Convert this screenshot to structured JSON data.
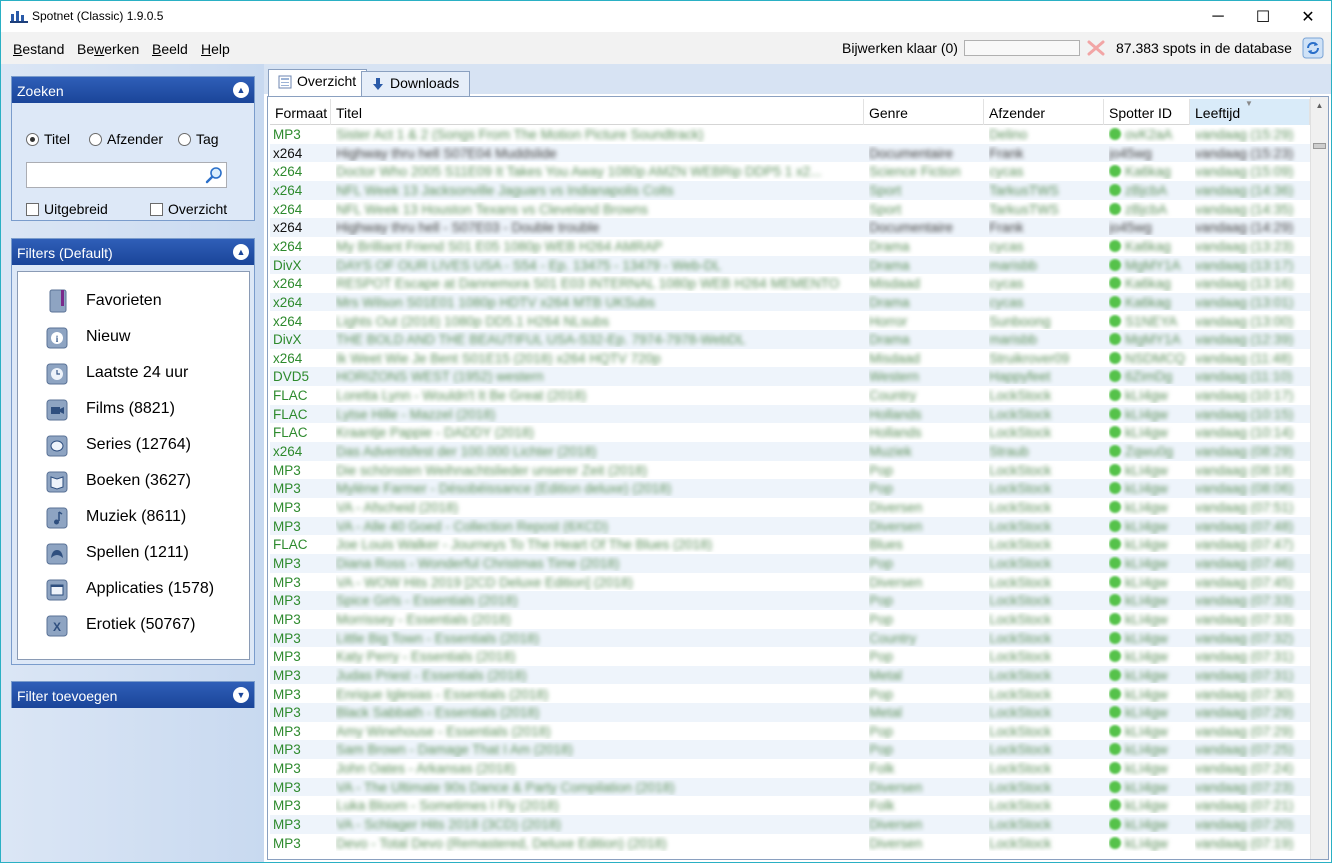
{
  "app": {
    "title": "Spotnet (Classic) 1.9.0.5",
    "window_controls": {
      "minimize": "─",
      "maximize": "☐",
      "close": "✕"
    }
  },
  "menu": {
    "items": [
      {
        "accel": "B",
        "rest": "estand"
      },
      {
        "pre": "Be",
        "accel": "w",
        "rest": "erken"
      },
      {
        "accel": "B",
        "rest": "eeld"
      },
      {
        "accel": "H",
        "rest": "elp"
      }
    ]
  },
  "status": {
    "update_label": "Bijwerken klaar (0)",
    "progress": 0,
    "spot_count": "87.383 spots in de database",
    "progress_color": "#06b025"
  },
  "search_panel": {
    "header": "Zoeken",
    "radios": [
      {
        "label": "Titel",
        "checked": true
      },
      {
        "label": "Afzender",
        "checked": false
      },
      {
        "label": "Tag",
        "checked": false
      }
    ],
    "search_value": "",
    "checkboxes": [
      {
        "label": "Uitgebreid",
        "checked": false
      },
      {
        "label": "Overzicht",
        "checked": false
      }
    ]
  },
  "filters_panel": {
    "header": "Filters (Default)",
    "items": [
      {
        "label": "Favorieten",
        "icon": "bookmark-icon"
      },
      {
        "label": "Nieuw",
        "icon": "info-icon"
      },
      {
        "label": "Laatste 24 uur",
        "icon": "clock-icon"
      },
      {
        "label": "Films (8821)",
        "icon": "video-camera-icon"
      },
      {
        "label": "Series (12764)",
        "icon": "tv-icon"
      },
      {
        "label": "Boeken (3627)",
        "icon": "book-icon"
      },
      {
        "label": "Muziek (8611)",
        "icon": "music-note-icon"
      },
      {
        "label": "Spellen (1211)",
        "icon": "gamepad-icon"
      },
      {
        "label": "Applicaties (1578)",
        "icon": "application-icon"
      },
      {
        "label": "Erotiek (50767)",
        "icon": "x-icon"
      }
    ]
  },
  "add_filter_panel": {
    "header": "Filter toevoegen"
  },
  "tabs": [
    {
      "label": "Overzicht",
      "active": true
    },
    {
      "label": "Downloads",
      "active": false
    }
  ],
  "grid": {
    "columns": [
      "Formaat",
      "Titel",
      "Genre",
      "Afzender",
      "Spotter ID",
      "Leeftijd"
    ],
    "sorted_column": "Leeftijd",
    "rows": [
      {
        "format": "MP3",
        "title": "Sister Act 1 & 2 (Songs From The Motion Picture Soundtrack)",
        "genre": "",
        "sender": "Delino",
        "spotter_id": "ovK2aA",
        "age": "vandaag (15:29)",
        "dark": false
      },
      {
        "format": "x264",
        "title": "Highway thru hell S07E04 Muddslide",
        "genre": "Documentaire",
        "sender": "Frank",
        "spotter_id": "jo45wg",
        "age": "vandaag (15:23)",
        "dark": true
      },
      {
        "format": "x264",
        "title": "Doctor Who 2005 S11E09 It Takes You Away 1080p AMZN WEBRip DDP5 1 x2...",
        "genre": "Science Fiction",
        "sender": "cycas",
        "spotter_id": "Ka6kag",
        "age": "vandaag (15:09)",
        "dark": false
      },
      {
        "format": "x264",
        "title": "NFL Week 13 Jacksonville Jaguars vs Indianapolis Colts",
        "genre": "Sport",
        "sender": "TarkusTWS",
        "spotter_id": "zBjcbA",
        "age": "vandaag (14:36)",
        "dark": false
      },
      {
        "format": "x264",
        "title": "NFL Week 13 Houston Texans vs Cleveland Browns",
        "genre": "Sport",
        "sender": "TarkusTWS",
        "spotter_id": "zBjcbA",
        "age": "vandaag (14:35)",
        "dark": false
      },
      {
        "format": "x264",
        "title": "Highway thru hell - S07E03 - Double trouble",
        "genre": "Documentaire",
        "sender": "Frank",
        "spotter_id": "jo45wg",
        "age": "vandaag (14:29)",
        "dark": true
      },
      {
        "format": "x264",
        "title": "My Brilliant Friend S01 E05 1080p WEB H264 AMRAP",
        "genre": "Drama",
        "sender": "cycas",
        "spotter_id": "Ka6kag",
        "age": "vandaag (13:23)",
        "dark": false
      },
      {
        "format": "DivX",
        "title": "DAYS OF OUR LIVES USA - S54 - Ep. 13475 - 13479 - Web-DL",
        "genre": "Drama",
        "sender": "marisbb",
        "spotter_id": "MgMY1A",
        "age": "vandaag (13:17)",
        "dark": false
      },
      {
        "format": "x264",
        "title": "RESPOT Escape at Dannemora S01 E03 INTERNAL 1080p WEB H264 MEMENTO",
        "genre": "Misdaad",
        "sender": "cycas",
        "spotter_id": "Ka6kag",
        "age": "vandaag (13:16)",
        "dark": false
      },
      {
        "format": "x264",
        "title": "Mrs Wilson S01E01 1080p HDTV x264 MTB UKSubs",
        "genre": "Drama",
        "sender": "cycas",
        "spotter_id": "Ka6kag",
        "age": "vandaag (13:01)",
        "dark": false
      },
      {
        "format": "x264",
        "title": "Lights Out (2016) 1080p DD5.1 H264 NLsubs",
        "genre": "Horror",
        "sender": "Sunboong",
        "spotter_id": "S1NEYA",
        "age": "vandaag (13:00)",
        "dark": false
      },
      {
        "format": "DivX",
        "title": "THE BOLD AND THE BEAUTIFUL USA-S32-Ep. 7974-7978-WebDL",
        "genre": "Drama",
        "sender": "marisbb",
        "spotter_id": "MgMY1A",
        "age": "vandaag (12:39)",
        "dark": false
      },
      {
        "format": "x264",
        "title": "Ik Weet Wie Je Bent S01E15 (2018) x264 HQTV 720p",
        "genre": "Misdaad",
        "sender": "Struikrover09",
        "spotter_id": "NSDMCQ",
        "age": "vandaag (11:48)",
        "dark": false
      },
      {
        "format": "DVD5",
        "title": "HORIZONS WEST (1952) western",
        "genre": "Western",
        "sender": "Happyfeet",
        "spotter_id": "6ZimDg",
        "age": "vandaag (11:10)",
        "dark": false
      },
      {
        "format": "FLAC",
        "title": "Loretta Lynn - Wouldn't It Be Great (2018)",
        "genre": "Country",
        "sender": "LockStock",
        "spotter_id": "kLI4gw",
        "age": "vandaag (10:17)",
        "dark": false
      },
      {
        "format": "FLAC",
        "title": "Lytse Hille - Mazzel (2018)",
        "genre": "Hollands",
        "sender": "LockStock",
        "spotter_id": "kLI4gw",
        "age": "vandaag (10:15)",
        "dark": false
      },
      {
        "format": "FLAC",
        "title": "Kraantje Pappie - DADDY (2018)",
        "genre": "Hollands",
        "sender": "LockStock",
        "spotter_id": "kLI4gw",
        "age": "vandaag (10:14)",
        "dark": false
      },
      {
        "format": "x264",
        "title": "Das Adventsfest der 100.000 Lichter (2018)",
        "genre": "Muziek",
        "sender": "Straub",
        "spotter_id": "Zqwu0g",
        "age": "vandaag (08:29)",
        "dark": false
      },
      {
        "format": "MP3",
        "title": "Die schönsten Weihnachtslieder unserer Zeit (2018)",
        "genre": "Pop",
        "sender": "LockStock",
        "spotter_id": "kLI4gw",
        "age": "vandaag (08:18)",
        "dark": false
      },
      {
        "format": "MP3",
        "title": "Mylène Farmer - Désobéissance (Edition deluxe) (2018)",
        "genre": "Pop",
        "sender": "LockStock",
        "spotter_id": "kLI4gw",
        "age": "vandaag (08:06)",
        "dark": false
      },
      {
        "format": "MP3",
        "title": "VA - Afscheid (2018)",
        "genre": "Diversen",
        "sender": "LockStock",
        "spotter_id": "kLI4gw",
        "age": "vandaag (07:51)",
        "dark": false
      },
      {
        "format": "MP3",
        "title": "VA - Alle 40 Goed - Collection Repost (6XCD)",
        "genre": "Diversen",
        "sender": "LockStock",
        "spotter_id": "kLI4gw",
        "age": "vandaag (07:48)",
        "dark": false
      },
      {
        "format": "FLAC",
        "title": "Joe Louis Walker - Journeys To The Heart Of The Blues (2018)",
        "genre": "Blues",
        "sender": "LockStock",
        "spotter_id": "kLI4gw",
        "age": "vandaag (07:47)",
        "dark": false
      },
      {
        "format": "MP3",
        "title": "Diana Ross - Wonderful Christmas Time (2018)",
        "genre": "Pop",
        "sender": "LockStock",
        "spotter_id": "kLI4gw",
        "age": "vandaag (07:46)",
        "dark": false
      },
      {
        "format": "MP3",
        "title": "VA - WOW Hits 2019 [2CD Deluxe Edition] (2018)",
        "genre": "Diversen",
        "sender": "LockStock",
        "spotter_id": "kLI4gw",
        "age": "vandaag (07:45)",
        "dark": false
      },
      {
        "format": "MP3",
        "title": "Spice Girls - Essentials (2018)",
        "genre": "Pop",
        "sender": "LockStock",
        "spotter_id": "kLI4gw",
        "age": "vandaag (07:33)",
        "dark": false
      },
      {
        "format": "MP3",
        "title": "Morrissey - Essentials (2018)",
        "genre": "Pop",
        "sender": "LockStock",
        "spotter_id": "kLI4gw",
        "age": "vandaag (07:33)",
        "dark": false
      },
      {
        "format": "MP3",
        "title": "Little Big Town - Essentials (2018)",
        "genre": "Country",
        "sender": "LockStock",
        "spotter_id": "kLI4gw",
        "age": "vandaag (07:32)",
        "dark": false
      },
      {
        "format": "MP3",
        "title": "Katy Perry - Essentials (2018)",
        "genre": "Pop",
        "sender": "LockStock",
        "spotter_id": "kLI4gw",
        "age": "vandaag (07:31)",
        "dark": false
      },
      {
        "format": "MP3",
        "title": "Judas Priest - Essentials (2018)",
        "genre": "Metal",
        "sender": "LockStock",
        "spotter_id": "kLI4gw",
        "age": "vandaag (07:31)",
        "dark": false
      },
      {
        "format": "MP3",
        "title": "Enrique Iglesias - Essentials (2018)",
        "genre": "Pop",
        "sender": "LockStock",
        "spotter_id": "kLI4gw",
        "age": "vandaag (07:30)",
        "dark": false
      },
      {
        "format": "MP3",
        "title": "Black Sabbath - Essentials (2018)",
        "genre": "Metal",
        "sender": "LockStock",
        "spotter_id": "kLI4gw",
        "age": "vandaag (07:29)",
        "dark": false
      },
      {
        "format": "MP3",
        "title": "Amy Winehouse - Essentials (2018)",
        "genre": "Pop",
        "sender": "LockStock",
        "spotter_id": "kLI4gw",
        "age": "vandaag (07:29)",
        "dark": false
      },
      {
        "format": "MP3",
        "title": "Sam Brown - Damage That I Am (2018)",
        "genre": "Pop",
        "sender": "LockStock",
        "spotter_id": "kLI4gw",
        "age": "vandaag (07:25)",
        "dark": false
      },
      {
        "format": "MP3",
        "title": "John Oates - Arkansas (2018)",
        "genre": "Folk",
        "sender": "LockStock",
        "spotter_id": "kLI4gw",
        "age": "vandaag (07:24)",
        "dark": false
      },
      {
        "format": "MP3",
        "title": "VA - The Ultimate 90s Dance & Party Compilation (2018)",
        "genre": "Diversen",
        "sender": "LockStock",
        "spotter_id": "kLI4gw",
        "age": "vandaag (07:23)",
        "dark": false
      },
      {
        "format": "MP3",
        "title": "Luka Bloom - Sometimes I Fly (2018)",
        "genre": "Folk",
        "sender": "LockStock",
        "spotter_id": "kLI4gw",
        "age": "vandaag (07:21)",
        "dark": false
      },
      {
        "format": "MP3",
        "title": "VA - Schlager Hits 2018 (3CD) (2018)",
        "genre": "Diversen",
        "sender": "LockStock",
        "spotter_id": "kLI4gw",
        "age": "vandaag (07:20)",
        "dark": false
      },
      {
        "format": "MP3",
        "title": "Devo - Total Devo (Remastered, Deluxe Edition) (2018)",
        "genre": "Diversen",
        "sender": "LockStock",
        "spotter_id": "kLI4gw",
        "age": "vandaag (07:19)",
        "dark": false
      }
    ]
  }
}
